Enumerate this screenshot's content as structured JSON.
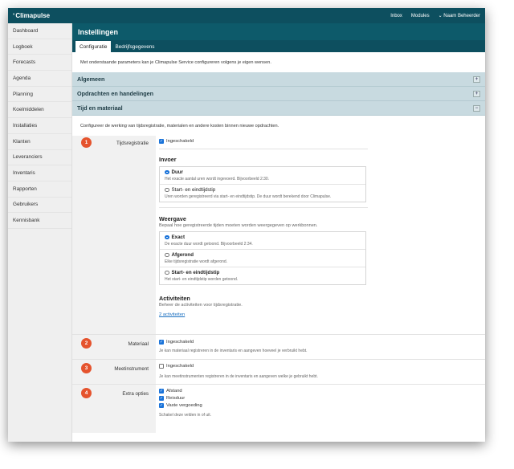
{
  "app": {
    "brand": "Climapulse",
    "nav": [
      "Inbox",
      "Modules",
      "Naam Beheerder"
    ]
  },
  "sidebar": {
    "items": [
      "Dashboard",
      "Logboek",
      "Forecasts",
      "Agenda",
      "Planning",
      "Koelmiddelen",
      "Installaties",
      "Klanten",
      "Leveranciers",
      "Inventaris",
      "Rapporten",
      "Gebruikers",
      "Kennisbank"
    ]
  },
  "page": {
    "title": "Instellingen",
    "tabs": [
      "Configuratie",
      "Bedrijfsgegevens"
    ],
    "intro": "Met onderstaande parameters kan je Climapulse Service configureren volgens je eigen wensen."
  },
  "sections": {
    "algemeen": "Algemeen",
    "opdrachten": "Opdrachten en handelingen",
    "tijd": "Tijd en materiaal",
    "collapsed_toggle": "+",
    "expanded_toggle": "−"
  },
  "tijd": {
    "intro": "Configureer de werking van tijdsregistratie, materialen en andere kosten binnen nieuwe opdrachten.",
    "tijdsregistratie": {
      "badge": "1",
      "label": "Tijdsregistratie",
      "checkbox": "Ingeschakeld",
      "checked": true,
      "invoer": {
        "title": "Invoer",
        "options": [
          {
            "title": "Duur",
            "desc": "Het exacte aantal uren wordt ingevoerd. Bijvoorbeeld 2:30.",
            "selected": true
          },
          {
            "title": "Start- en eindtijdstip",
            "desc": "Uren worden geregistreerd via start- en eindtijdstip. De duur wordt berekend door Climapulse.",
            "selected": false
          }
        ]
      },
      "weergave": {
        "title": "Weergave",
        "subtitle": "Bepaal hoe geregistreerde tijden moeten worden weergegeven op werkbonnen.",
        "options": [
          {
            "title": "Exact",
            "desc": "De exacte duur wordt getoond. Bijvoorbeeld 2:34.",
            "selected": true
          },
          {
            "title": "Afgerond",
            "desc": "Elke tijdsregistratie wordt afgerond.",
            "selected": false
          },
          {
            "title": "Start- en eindtijdstip",
            "desc": "Het start- en eindtijdstip worden getoond.",
            "selected": false
          }
        ]
      },
      "activiteiten": {
        "title": "Activiteiten",
        "subtitle": "Beheer de activiteiten voor tijdsregistratie.",
        "link": "2 activiteiten"
      }
    },
    "materiaal": {
      "badge": "2",
      "label": "Materiaal",
      "checkbox": "Ingeschakeld",
      "checked": true,
      "hint": "Je kan materiaal registreren in de inventaris en aangeven hoeveel je verbruikt hebt."
    },
    "meetinstrument": {
      "badge": "3",
      "label": "Meetinstrument",
      "checkbox": "Ingeschakeld",
      "checked": false,
      "hint": "Je kan meetinstrumenten registreren in de inventaris en aangeven welke je gebruikt hebt."
    },
    "extra": {
      "badge": "4",
      "label": "Extra opties",
      "options": [
        "Afstand",
        "Reisduur",
        "Vaste vergoeding"
      ],
      "hint": "Schakel deze velden in of uit."
    }
  },
  "colors": {
    "header": "#0d4f5f",
    "section": "#c8dae0",
    "badge": "#e5532d",
    "accent": "#1a73d9"
  }
}
